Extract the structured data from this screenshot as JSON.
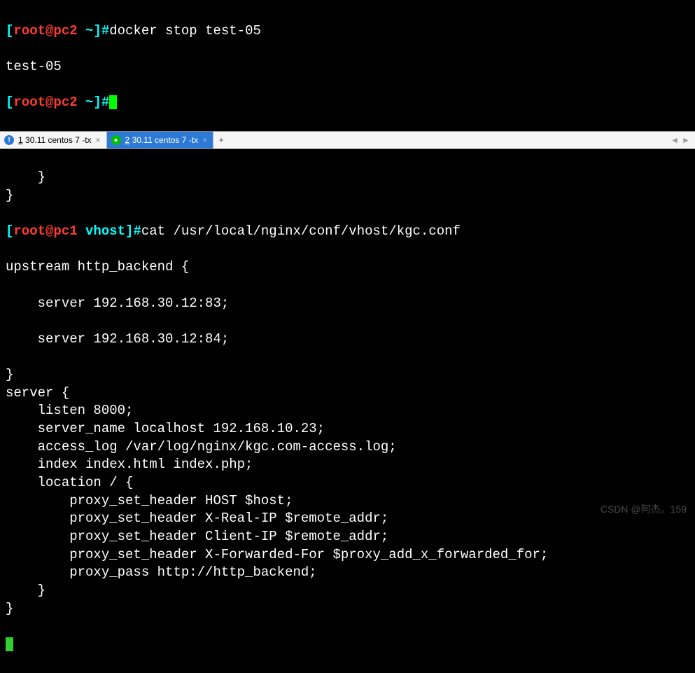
{
  "top_session": {
    "prompt_open": "[",
    "user_host": "root@pc2",
    "cwd": " ~",
    "prompt_close": "]#",
    "command": "docker stop test-05",
    "output_line": "test-05"
  },
  "tabs": {
    "items": [
      {
        "index": "1",
        "label": "30.11 centos 7 -tx",
        "active": false
      },
      {
        "index": "2",
        "label": "30.11 centos 7 -tx",
        "active": true
      }
    ],
    "add_label": "+",
    "left_arrow": "◄",
    "right_arrow": "►"
  },
  "main_session": {
    "pre_lines": [
      "    }",
      "}"
    ],
    "prompt_open": "[",
    "user_host": "root@pc1",
    "cwd": " vhost",
    "prompt_close": "]#",
    "command": "cat /usr/local/nginx/conf/vhost/kgc.conf",
    "file_lines": [
      "upstream http_backend {",
      "",
      "    server 192.168.30.12:83;",
      "",
      "    server 192.168.30.12:84;",
      "",
      "}",
      "server {",
      "    listen 8000;",
      "    server_name localhost 192.168.10.23;",
      "    access_log /var/log/nginx/kgc.com-access.log;",
      "    index index.html index.php;",
      "    location / {",
      "        proxy_set_header HOST $host;",
      "        proxy_set_header X-Real-IP $remote_addr;",
      "        proxy_set_header Client-IP $remote_addr;",
      "        proxy_set_header X-Forwarded-For $proxy_add_x_forwarded_for;",
      "        proxy_pass http://http_backend;",
      "    }",
      "}"
    ]
  },
  "watermark": "CSDN @阿杰。159"
}
